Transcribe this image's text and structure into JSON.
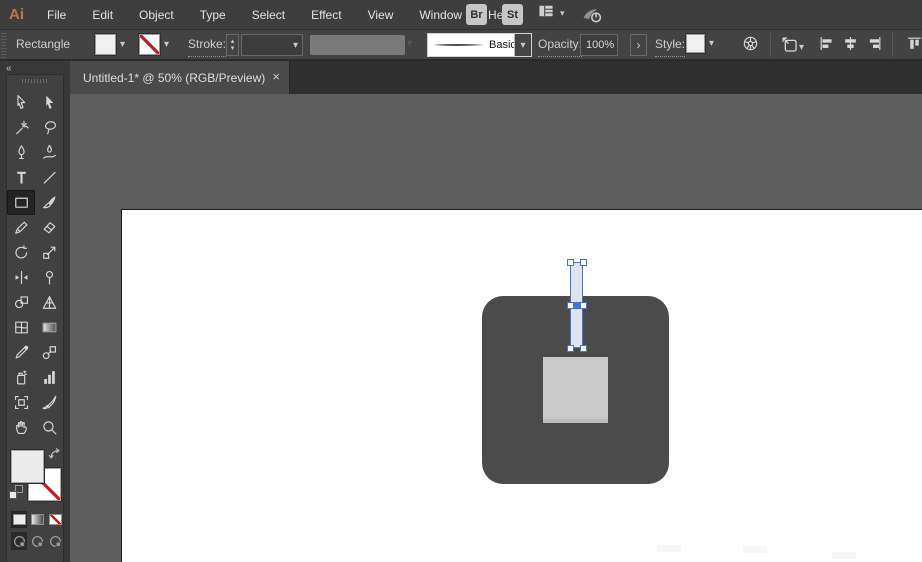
{
  "menubar": {
    "logo": "Ai",
    "items": [
      "File",
      "Edit",
      "Object",
      "Type",
      "Select",
      "Effect",
      "View",
      "Window",
      "Help"
    ],
    "bridge": "Br",
    "stock": "St"
  },
  "optionsbar": {
    "tool_label": "Rectangle",
    "stroke_label": "Stroke:",
    "brush_value": "Basic",
    "opacity_label": "Opacity:",
    "opacity_value": "100%",
    "style_label": "Style:"
  },
  "tabbar": {
    "title": "Untitled-1* @ 50% (RGB/Preview)"
  },
  "glyphs": {
    "collapse": "«",
    "chevron_down": "▾",
    "chevron_up": "▴",
    "chevron_right": "›",
    "close": "×"
  },
  "tools": [
    "selection",
    "direct-selection",
    "magic-wand",
    "lasso",
    "pen",
    "curvature-pen",
    "type",
    "line-segment",
    "rectangle",
    "paintbrush",
    "shaper",
    "eraser",
    "rotate",
    "scale",
    "width",
    "puppet-warp",
    "shape-builder",
    "perspective-grid",
    "mesh",
    "gradient",
    "eyedropper",
    "blend",
    "symbol-sprayer",
    "column-graph",
    "artboard",
    "slice",
    "hand",
    "zoom"
  ],
  "selected_tool": "rectangle",
  "document": {
    "zoom_level": "50%",
    "color_mode": "RGB/Preview",
    "name": "Untitled-1*"
  },
  "colors": {
    "selection_blue": "#4573d8",
    "artwork_dark_square": "#4b4b4b",
    "artwork_inner_square": "#c9c9c9",
    "selected_rect_fill": "#dfe3ee",
    "pasteboard": "#5d5d5d",
    "artboard": "#ffffff",
    "ui_bar": "#3e3e3e",
    "logo_orange": "#c0754a",
    "none_slash_red": "#c21d1d"
  }
}
